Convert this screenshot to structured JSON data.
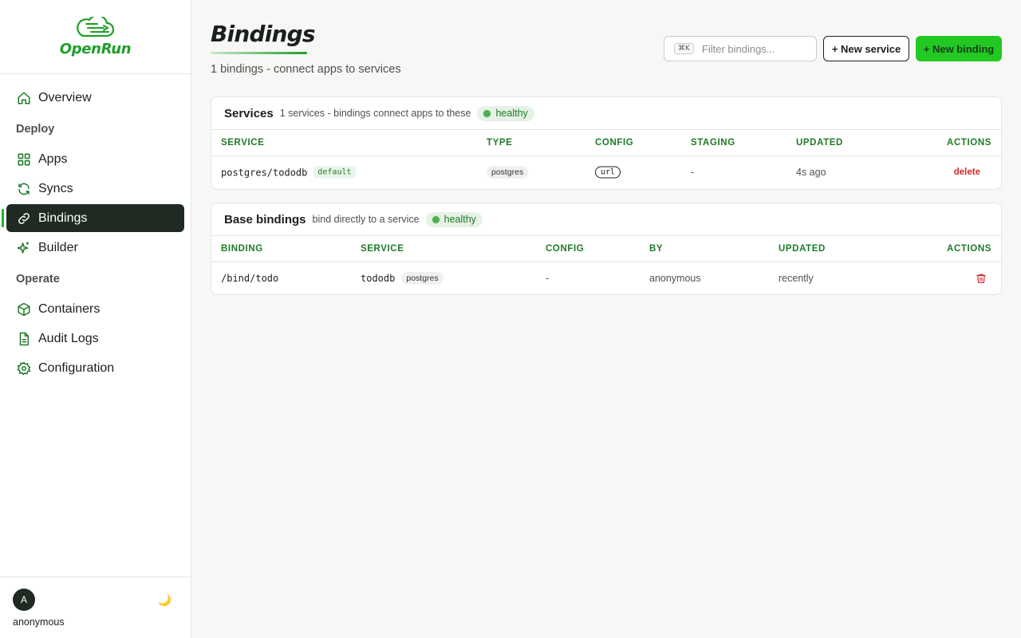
{
  "brand": {
    "name": "OpenRun"
  },
  "sidebar": {
    "items": [
      {
        "label": "Overview",
        "icon": "home-icon"
      },
      {
        "section": "Deploy"
      },
      {
        "label": "Apps",
        "icon": "grid-icon"
      },
      {
        "label": "Syncs",
        "icon": "refresh-icon"
      },
      {
        "label": "Bindings",
        "icon": "link-icon",
        "active": true
      },
      {
        "label": "Builder",
        "icon": "sparkle-icon"
      },
      {
        "section": "Operate"
      },
      {
        "label": "Containers",
        "icon": "box-icon"
      },
      {
        "label": "Audit Logs",
        "icon": "document-icon"
      },
      {
        "label": "Configuration",
        "icon": "gear-icon"
      }
    ],
    "labels": {
      "overview": "Overview",
      "deploy": "Deploy",
      "apps": "Apps",
      "syncs": "Syncs",
      "bindings": "Bindings",
      "builder": "Builder",
      "operate": "Operate",
      "containers": "Containers",
      "audit_logs": "Audit Logs",
      "configuration": "Configuration"
    }
  },
  "user": {
    "initial": "A",
    "name": "anonymous"
  },
  "page": {
    "title": "Bindings",
    "subtitle": "1 bindings - connect apps to services",
    "search_shortcut": "⌘K",
    "search_placeholder": "Filter bindings...",
    "new_service_label": "+ New service",
    "new_binding_label": "+ New binding"
  },
  "services": {
    "title": "Services",
    "description": "1 services - bindings connect apps to these",
    "status": "healthy",
    "columns": [
      "SERVICE",
      "TYPE",
      "CONFIG",
      "STAGING",
      "UPDATED",
      "ACTIONS"
    ],
    "rows": [
      {
        "service": "postgres/tododb",
        "tag": "default",
        "type": "postgres",
        "config": "url",
        "staging": "-",
        "updated": "4s ago",
        "action": "delete"
      }
    ]
  },
  "base_bindings": {
    "title": "Base bindings",
    "description": "bind directly to a service",
    "status": "healthy",
    "columns": [
      "BINDING",
      "SERVICE",
      "CONFIG",
      "BY",
      "UPDATED",
      "ACTIONS"
    ],
    "rows": [
      {
        "binding": "/bind/todo",
        "service": "tododb",
        "service_type": "postgres",
        "config": "-",
        "by": "anonymous",
        "updated": "recently"
      }
    ]
  },
  "colors": {
    "accent": "#22c922",
    "brand_green": "#1e9e2a",
    "active_nav_bg": "#1f2a22",
    "delete_red": "#d12b2b",
    "header_green": "#1e7a27"
  }
}
